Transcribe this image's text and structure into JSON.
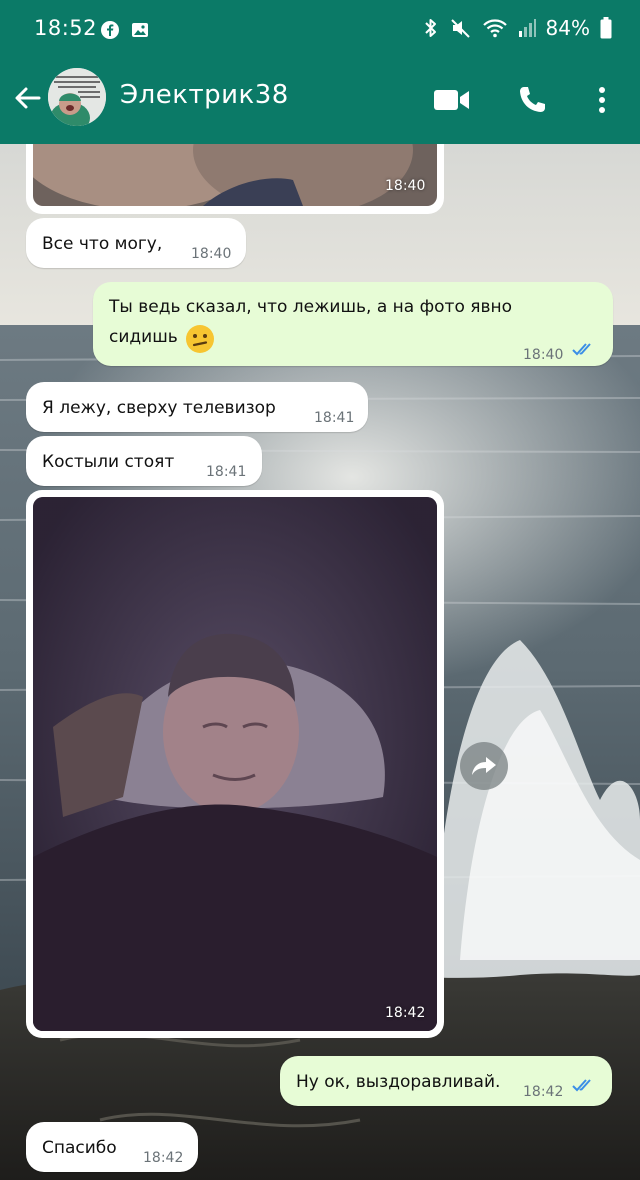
{
  "status_bar": {
    "time": "18:52",
    "battery": "84%",
    "icons": [
      "facebook-icon",
      "gallery-icon",
      "bluetooth-icon",
      "mute-icon",
      "wifi-icon",
      "signal-icon",
      "battery-icon"
    ]
  },
  "header": {
    "contact_name": "Электрик38",
    "icons": [
      "back-arrow-icon",
      "video-call-icon",
      "phone-call-icon",
      "more-vert-icon"
    ]
  },
  "colors": {
    "header_bg": "#0b7a67",
    "incoming_bubble": "#ffffff",
    "outgoing_bubble": "#e7fcd6",
    "read_ticks": "#3b8ee6"
  },
  "messages": [
    {
      "direction": "in",
      "kind": "photo",
      "time": "18:40"
    },
    {
      "direction": "in",
      "kind": "text",
      "text": "Все что могу,",
      "time": "18:40"
    },
    {
      "direction": "out",
      "kind": "text",
      "text_line1": "Ты ведь сказал,  что лежишь, а на фото явно",
      "text_line2": "сидишь",
      "emoji": "confused-face-emoji",
      "time": "18:40",
      "status": "read"
    },
    {
      "direction": "in",
      "kind": "text",
      "text": "Я лежу, сверху телевизор",
      "time": "18:41"
    },
    {
      "direction": "in",
      "kind": "text",
      "text": "Костыли стоят",
      "time": "18:41"
    },
    {
      "direction": "in",
      "kind": "photo",
      "time": "18:42"
    },
    {
      "direction": "out",
      "kind": "text",
      "text": "Ну ок, выздоравливай.",
      "time": "18:42",
      "status": "read"
    },
    {
      "direction": "in",
      "kind": "text",
      "text": "Спасибо",
      "time": "18:42"
    }
  ]
}
